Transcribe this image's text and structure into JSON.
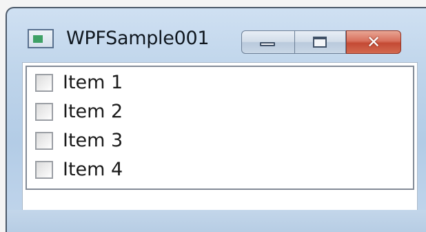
{
  "window": {
    "title": "WPFSample001",
    "icon": "window-app-icon",
    "controls": {
      "minimize": "minimize-icon",
      "maximize": "maximize-icon",
      "close": "close-icon",
      "close_glyph": "✕"
    }
  },
  "list": {
    "items": [
      {
        "label": "Item 1",
        "checked": false
      },
      {
        "label": "Item 2",
        "checked": false
      },
      {
        "label": "Item 3",
        "checked": false
      },
      {
        "label": "Item 4",
        "checked": false
      }
    ]
  },
  "colors": {
    "close_button": "#c44a34",
    "frame": "#b3cce6"
  }
}
